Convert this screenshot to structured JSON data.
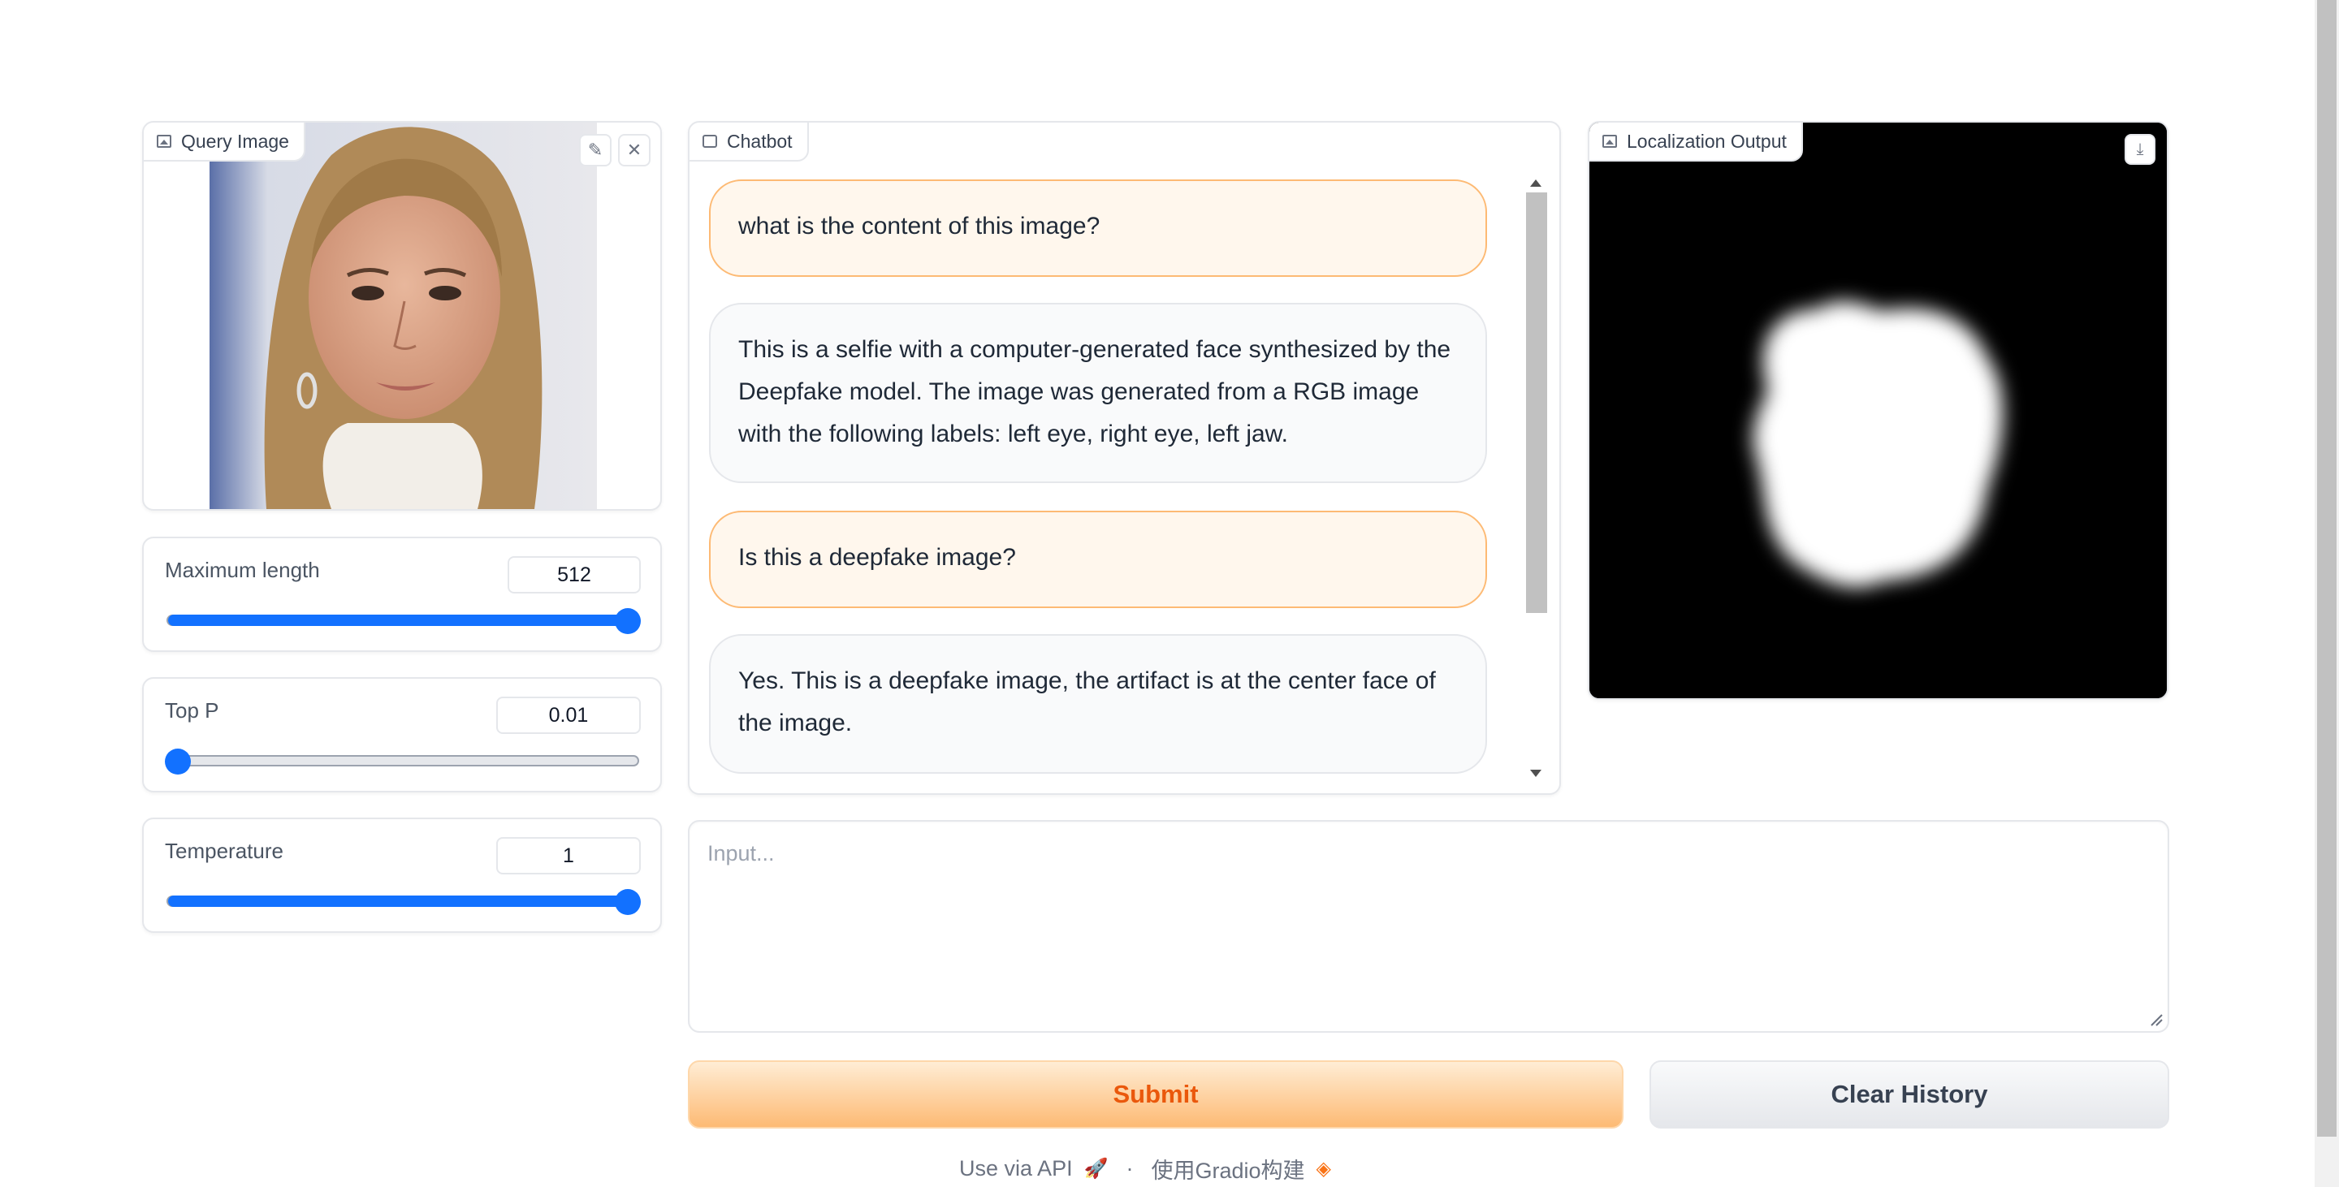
{
  "query_image": {
    "label": "Query Image"
  },
  "sliders": [
    {
      "label": "Maximum length",
      "value": "512",
      "fraction": 1.0
    },
    {
      "label": "Top P",
      "value": "0.01",
      "fraction": 0.0
    },
    {
      "label": "Temperature",
      "value": "1",
      "fraction": 1.0
    }
  ],
  "chatbot": {
    "label": "Chatbot",
    "messages": [
      {
        "role": "user",
        "text": "what is the content of this image?"
      },
      {
        "role": "bot",
        "text": "This is a selfie with a computer-generated face synthesized by the Deepfake model. The image was generated from a RGB image with the following labels: left eye, right eye, left jaw."
      },
      {
        "role": "user",
        "text": "Is this a deepfake image?"
      },
      {
        "role": "bot",
        "text": "Yes. This is a deepfake image, the artifact is at the center face of the image."
      }
    ]
  },
  "localization": {
    "label": "Localization Output"
  },
  "input": {
    "placeholder": "Input..."
  },
  "buttons": {
    "submit": "Submit",
    "clear": "Clear History"
  },
  "footer": {
    "api": "Use via API",
    "separator": "·",
    "built_with": "使用Gradio构建"
  },
  "colors": {
    "accent_blue": "#1271ff",
    "submit_text": "#ea580c",
    "user_bubble": "#fff7ed",
    "bot_bubble": "#f9fafb"
  }
}
